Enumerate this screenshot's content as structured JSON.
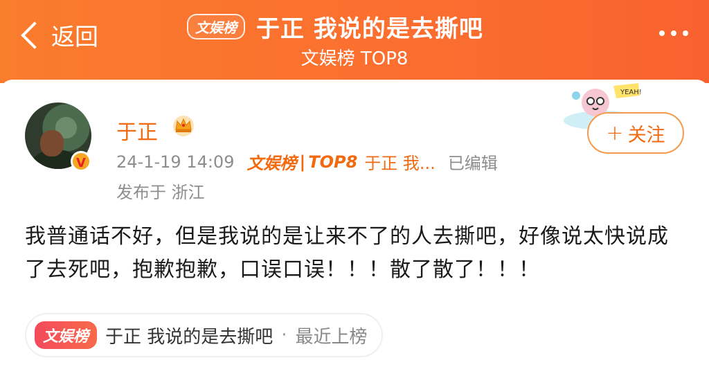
{
  "header": {
    "back_label": "返回",
    "brand_pill": "文娱榜",
    "title": "于正 我说的是去撕吧",
    "subtitle": "文娱榜 TOP8",
    "more_icon": "more-icon"
  },
  "post": {
    "username": "于正",
    "timestamp": "24-1-19 14:09",
    "source_brand": "文娱榜",
    "source_sep": "|",
    "source_rank": "TOP8",
    "source_title": "于正 我...",
    "edited": "已编辑",
    "location": "发布于 浙江",
    "follow_label": "关注",
    "follow_plus": "+",
    "verified_badge": "V",
    "text": "我普通话不好，但是我说的是让来不了的人去撕吧，好像说太快说成了去死吧，抱歉抱歉，口误口误！！！散了散了！！！"
  },
  "topic_chip": {
    "badge": "文娱榜",
    "title": "于正 我说的是去撕吧",
    "dot": "·",
    "status": "最近上榜"
  },
  "colors": {
    "header_orange": "#fa7c2d",
    "brand_orange": "#f26a10",
    "meta_gray": "#8d8d8d"
  }
}
